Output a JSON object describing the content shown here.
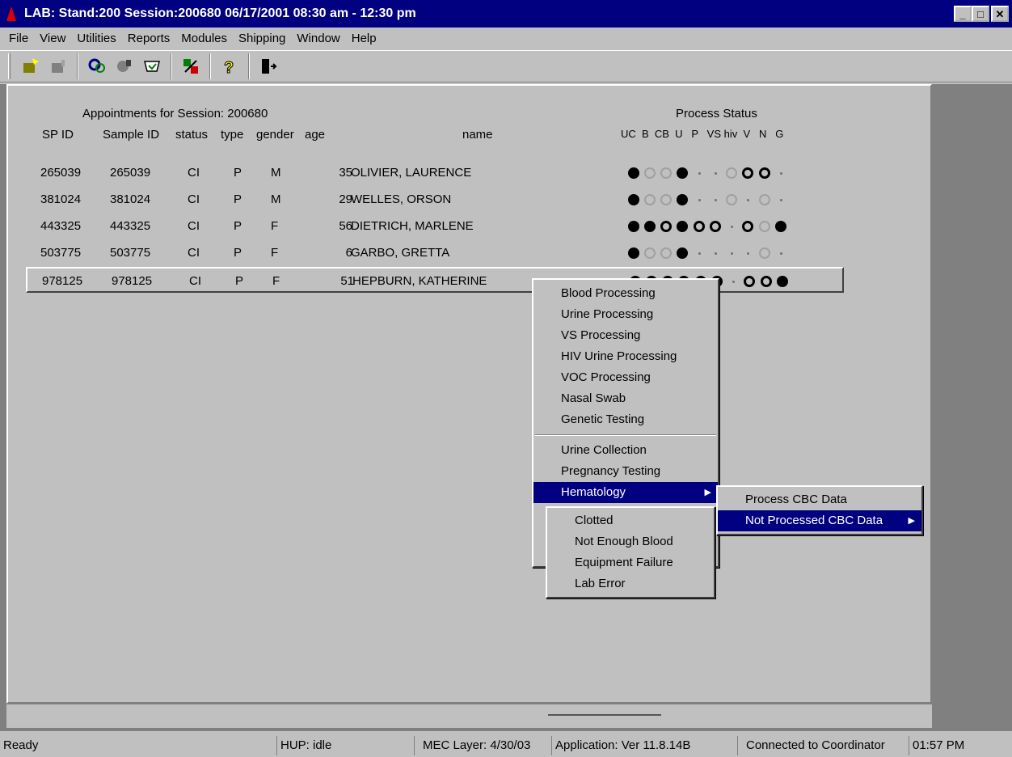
{
  "window": {
    "title": "LAB: Stand:200 Session:200680 06/17/2001 08:30 am - 12:30 pm",
    "minimize": "_",
    "maximize": "□",
    "close": "✕"
  },
  "menubar": [
    "File",
    "View",
    "Utilities",
    "Reports",
    "Modules",
    "Shipping",
    "Window",
    "Help"
  ],
  "toolbar": [
    "new-session-icon",
    "close-session-icon",
    "find-icon",
    "sample-icon",
    "ship-icon",
    "switch-icon",
    "help-icon",
    "exit-icon"
  ],
  "session": {
    "heading": "Appointments for Session: 200680",
    "process_heading": "Process Status",
    "columns": [
      "SP ID",
      "Sample ID",
      "status",
      "type",
      "gender",
      "age",
      "name"
    ],
    "status_columns": "UC  B  CB  U   P   VS hiv  V   N   G",
    "rows": [
      {
        "spid": "265039",
        "sample": "265039",
        "status": "CI",
        "type": "P",
        "gender": "M",
        "age": "35",
        "name": "OLIVIER, LAURENCE",
        "dots": [
          "filled",
          "gray",
          "gray",
          "filled",
          "small",
          "small",
          "gray",
          "hollow",
          "hollow",
          "small"
        ]
      },
      {
        "spid": "381024",
        "sample": "381024",
        "status": "CI",
        "type": "P",
        "gender": "M",
        "age": "29",
        "name": "WELLES, ORSON",
        "dots": [
          "filled",
          "gray",
          "gray",
          "filled",
          "small",
          "small",
          "gray",
          "small",
          "gray",
          "small"
        ]
      },
      {
        "spid": "443325",
        "sample": "443325",
        "status": "CI",
        "type": "P",
        "gender": "F",
        "age": "56",
        "name": "DIETRICH, MARLENE",
        "dots": [
          "filled",
          "filled",
          "hollow",
          "filled",
          "hollow",
          "hollow",
          "small",
          "hollow",
          "gray",
          "filled"
        ]
      },
      {
        "spid": "503775",
        "sample": "503775",
        "status": "CI",
        "type": "P",
        "gender": "F",
        "age": "6",
        "name": "GARBO, GRETTA",
        "dots": [
          "filled",
          "gray",
          "gray",
          "filled",
          "small",
          "small",
          "small",
          "small",
          "gray",
          "small"
        ]
      },
      {
        "spid": "978125",
        "sample": "978125",
        "status": "CI",
        "type": "P",
        "gender": "F",
        "age": "51",
        "name": "HEPBURN, KATHERINE",
        "dots": [
          "filled",
          "filled",
          "hollow",
          "filled",
          "hollow",
          "hollow",
          "small",
          "hollow",
          "hollow",
          "filled"
        ]
      }
    ]
  },
  "context_menu": {
    "group1": [
      "Blood Processing",
      "Urine Processing",
      "VS Processing",
      "HIV Urine Processing",
      "VOC Processing",
      "Nasal Swab",
      "Genetic Testing"
    ],
    "group2": [
      "Urine Collection",
      "Pregnancy Testing",
      "Hematology"
    ]
  },
  "hematology_menu": [
    "Process CBC Data",
    "Not Processed CBC Data"
  ],
  "not_processed_menu": [
    "Clotted",
    "Not Enough Blood",
    "Equipment Failure",
    "Lab Error"
  ],
  "status": {
    "ready": "Ready",
    "hup": "HUP: idle",
    "mec": "MEC Layer: 4/30/03",
    "app": "Application: Ver 11.8.14B",
    "conn": "Connected to Coordinator",
    "time": "01:57 PM"
  }
}
